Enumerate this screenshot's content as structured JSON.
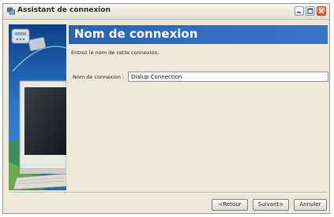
{
  "window": {
    "title": "Assistant de connexion",
    "icon": "network-wizard-icon"
  },
  "side_panel": {
    "illustration": "computer-globe-illustration"
  },
  "header": {
    "title": "Nom de connexion"
  },
  "main": {
    "subtitle": "Entrez le nom de cette connexion.",
    "field_label": "Nom de connexion :",
    "field_value": "Dialup Connection"
  },
  "buttons": {
    "previous": "<Retour",
    "next": "Suivant>",
    "cancel": "Annuler"
  },
  "colors": {
    "header_blue": "#2e68b8",
    "window_bg": "#ece9d8"
  }
}
